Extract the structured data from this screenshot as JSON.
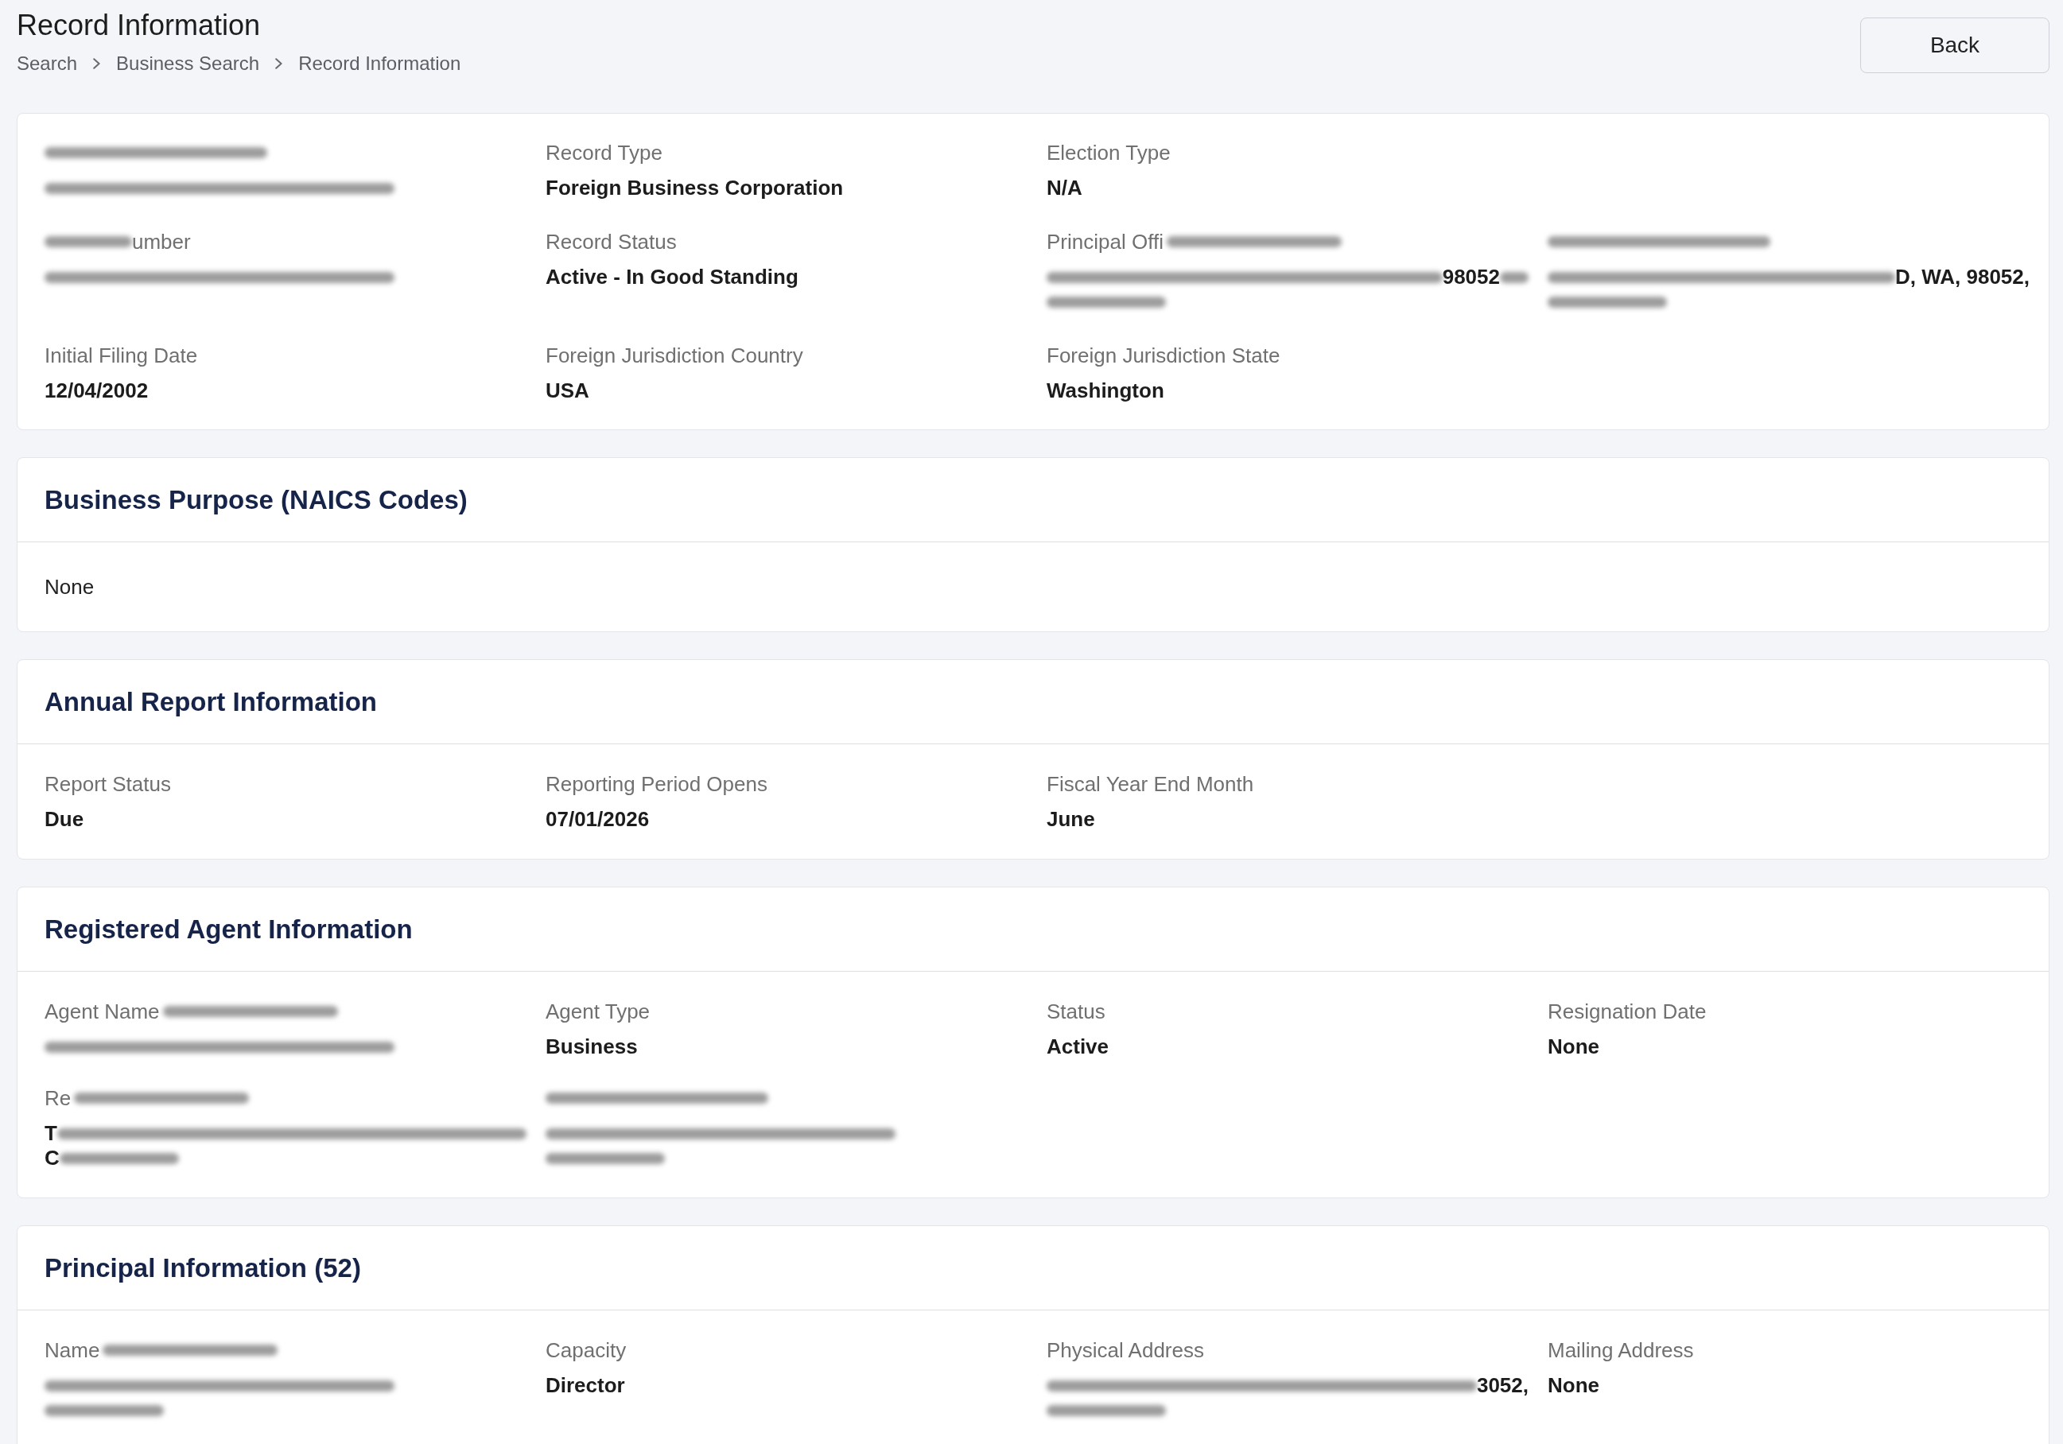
{
  "header": {
    "title": "Record Information",
    "breadcrumb": [
      "Search",
      "Business Search",
      "Record Information"
    ],
    "back_button": "Back"
  },
  "summary": {
    "rows": [
      [
        {
          "kind": "partial",
          "label": [
            {
              "kind": "blur"
            }
          ],
          "value": [
            [
              {
                "kind": "blur"
              }
            ]
          ]
        },
        {
          "kind": "plain",
          "label": "Record Type",
          "value": "Foreign Business Corporation"
        },
        {
          "kind": "plain",
          "label": "Election Type",
          "value": "N/A"
        }
      ],
      [
        {
          "kind": "partial",
          "label": [
            {
              "kind": "blur"
            },
            {
              "kind": "text",
              "text": "umber"
            }
          ],
          "value": [
            [
              {
                "kind": "blur"
              }
            ]
          ]
        },
        {
          "kind": "plain",
          "label": "Record Status",
          "value": "Active - In Good Standing"
        },
        {
          "kind": "partial",
          "label": [
            {
              "kind": "text",
              "text": "Principal Offi"
            },
            {
              "kind": "blur"
            }
          ],
          "value": [
            [
              {
                "kind": "blur"
              },
              {
                "kind": "text",
                "text": "98052"
              },
              {
                "kind": "blur"
              }
            ],
            [
              {
                "kind": "blur"
              }
            ]
          ]
        },
        {
          "kind": "partial",
          "label": [
            {
              "kind": "blur"
            }
          ],
          "value": [
            [
              {
                "kind": "blur"
              },
              {
                "kind": "text",
                "text": "D, WA, 98052,"
              }
            ],
            [
              {
                "kind": "blur"
              }
            ]
          ]
        }
      ],
      [
        {
          "kind": "plain",
          "label": "Initial Filing Date",
          "value": "12/04/2002"
        },
        {
          "kind": "plain",
          "label": "Foreign Jurisdiction Country",
          "value": "USA"
        },
        {
          "kind": "plain",
          "label": "Foreign Jurisdiction State",
          "value": "Washington"
        }
      ]
    ]
  },
  "sections": [
    {
      "kind": "text",
      "title": "Business Purpose (NAICS Codes)",
      "text": "None"
    },
    {
      "kind": "fields",
      "title": "Annual Report Information",
      "rows": [
        [
          {
            "kind": "plain",
            "label": "Report Status",
            "value": "Due"
          },
          {
            "kind": "plain",
            "label": "Reporting Period Opens",
            "value": "07/01/2026"
          },
          {
            "kind": "plain",
            "label": "Fiscal Year End Month",
            "value": "June"
          }
        ]
      ]
    },
    {
      "kind": "fields",
      "title": "Registered Agent Information",
      "rows": [
        [
          {
            "kind": "partial",
            "label": [
              {
                "kind": "text",
                "text": "Agent Name"
              },
              {
                "kind": "blur"
              }
            ],
            "value": [
              [
                {
                  "kind": "blur"
                }
              ]
            ]
          },
          {
            "kind": "plain",
            "label": "Agent Type",
            "value": "Business"
          },
          {
            "kind": "plain",
            "label": "Status",
            "value": "Active"
          },
          {
            "kind": "plain",
            "label": "Resignation Date",
            "value": "None"
          }
        ],
        [
          {
            "kind": "partial",
            "label": [
              {
                "kind": "text",
                "text": "Re"
              },
              {
                "kind": "blur"
              }
            ],
            "value": [
              [
                {
                  "kind": "text",
                  "text": "T"
                },
                {
                  "kind": "blur"
                }
              ],
              [
                {
                  "kind": "text",
                  "text": "C"
                },
                {
                  "kind": "blur"
                }
              ]
            ]
          },
          {
            "kind": "partial",
            "label": [
              {
                "kind": "blur"
              }
            ],
            "value": [
              [
                {
                  "kind": "blur"
                }
              ],
              [
                {
                  "kind": "blur"
                }
              ]
            ]
          }
        ]
      ]
    },
    {
      "kind": "fields",
      "title": "Principal Information (52)",
      "rows": [
        [
          {
            "kind": "partial",
            "label": [
              {
                "kind": "text",
                "text": "Name"
              },
              {
                "kind": "blur"
              }
            ],
            "value": [
              [
                {
                  "kind": "blur"
                }
              ],
              [
                {
                  "kind": "blur"
                }
              ]
            ]
          },
          {
            "kind": "plain",
            "label": "Capacity",
            "value": "Director"
          },
          {
            "kind": "partial",
            "label": [
              {
                "kind": "text",
                "text": "Physical Address"
              }
            ],
            "value": [
              [
                {
                  "kind": "blur"
                },
                {
                  "kind": "text",
                  "text": "3052,"
                }
              ],
              [
                {
                  "kind": "blur"
                }
              ]
            ]
          },
          {
            "kind": "plain",
            "label": "Mailing Address",
            "value": "None"
          }
        ]
      ]
    }
  ]
}
